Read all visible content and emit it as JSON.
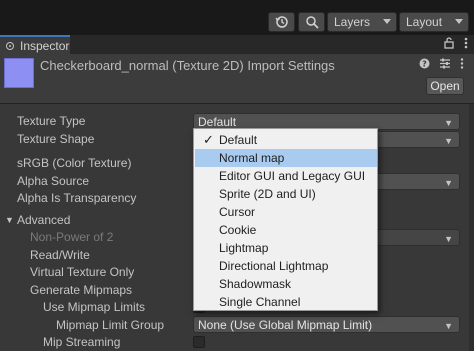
{
  "toolbar": {
    "history_icon": "history-icon",
    "search_icon": "search-icon",
    "layers_label": "Layers",
    "layout_label": "Layout"
  },
  "tab": {
    "label": "Inspector",
    "lock_icon": "lock-icon",
    "menu_icon": "kebab-menu-icon"
  },
  "header": {
    "title": "Checkerboard_normal (Texture 2D) Import Settings",
    "help_icon": "help-icon",
    "presets_icon": "presets-icon",
    "menu_icon": "kebab-menu-icon",
    "open_label": "Open",
    "thumbnail_color": "#8d8ff3"
  },
  "fields": {
    "texture_type_label": "Texture Type",
    "texture_type_value": "Default",
    "texture_shape_label": "Texture Shape",
    "srgb_label": "sRGB (Color Texture)",
    "alpha_source_label": "Alpha Source",
    "alpha_transparency_label": "Alpha Is Transparency",
    "advanced_label": "Advanced",
    "non_power_label": "Non-Power of 2",
    "read_write_label": "Read/Write",
    "virtual_texture_label": "Virtual Texture Only",
    "generate_mipmaps_label": "Generate Mipmaps",
    "use_mipmap_limits_label": "Use Mipmap Limits",
    "mipmap_limit_group_label": "Mipmap Limit Group",
    "mipmap_limit_group_value": "None (Use Global Mipmap Limit)",
    "mip_streaming_label": "Mip Streaming"
  },
  "popup": {
    "selected": "Default",
    "highlighted": "Normal map",
    "items": [
      "Default",
      "Normal map",
      "Editor GUI and Legacy GUI",
      "Sprite (2D and UI)",
      "Cursor",
      "Cookie",
      "Lightmap",
      "Directional Lightmap",
      "Shadowmask",
      "Single Channel"
    ]
  },
  "colors": {
    "background": "#383838",
    "toolbar": "#191919",
    "accent": "#3a79bb",
    "popup_bg": "#f0f0f0",
    "popup_highlight": "#a9cbf0"
  }
}
